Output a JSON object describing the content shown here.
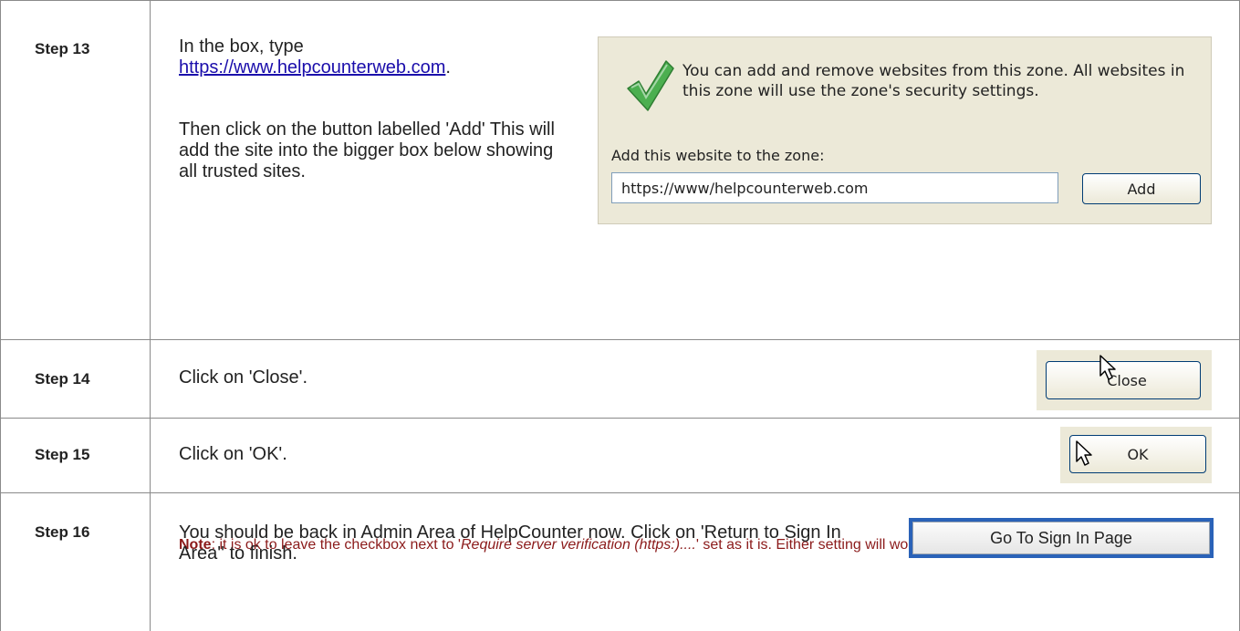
{
  "steps": [
    {
      "label": "Step 13",
      "text_line1": "In the box, type",
      "link": "https://www.helpcounterweb.com",
      "link_suffix": ".",
      "text_para2": "Then click on the button labelled 'Add' This will add the site into the bigger box below showing all trusted sites.",
      "note_label": "Note",
      "note_text_before": ": it is ok to leave the checkbox next to '",
      "note_italic": "Require server verification (https:)....",
      "note_text_after": "' set as it is. Either setting will work for HelpCounter.",
      "panel": {
        "message": "You can add and remove websites from this zone. All websites in this zone will use the zone's security settings.",
        "add_label": "Add this website to the zone:",
        "input_value": "https://www/helpcounterweb.com",
        "add_button": "Add"
      }
    },
    {
      "label": "Step 14",
      "text": "Click on 'Close'.",
      "button": "Close"
    },
    {
      "label": "Step 15",
      "text": "Click on 'OK'.",
      "button": "OK"
    },
    {
      "label": "Step 16",
      "text": "You should be back in Admin Area of HelpCounter now. Click on 'Return to Sign In Area'' to finish.",
      "button": "Go To Sign In Page"
    }
  ],
  "colors": {
    "link": "#1a0dab",
    "note": "#8b1a1a",
    "xp_panel": "#ece9d8",
    "check": "#4caf50",
    "go_button_frame": "#2a62b8"
  },
  "icons": [
    "checkmark-icon",
    "mouse-cursor-icon"
  ]
}
